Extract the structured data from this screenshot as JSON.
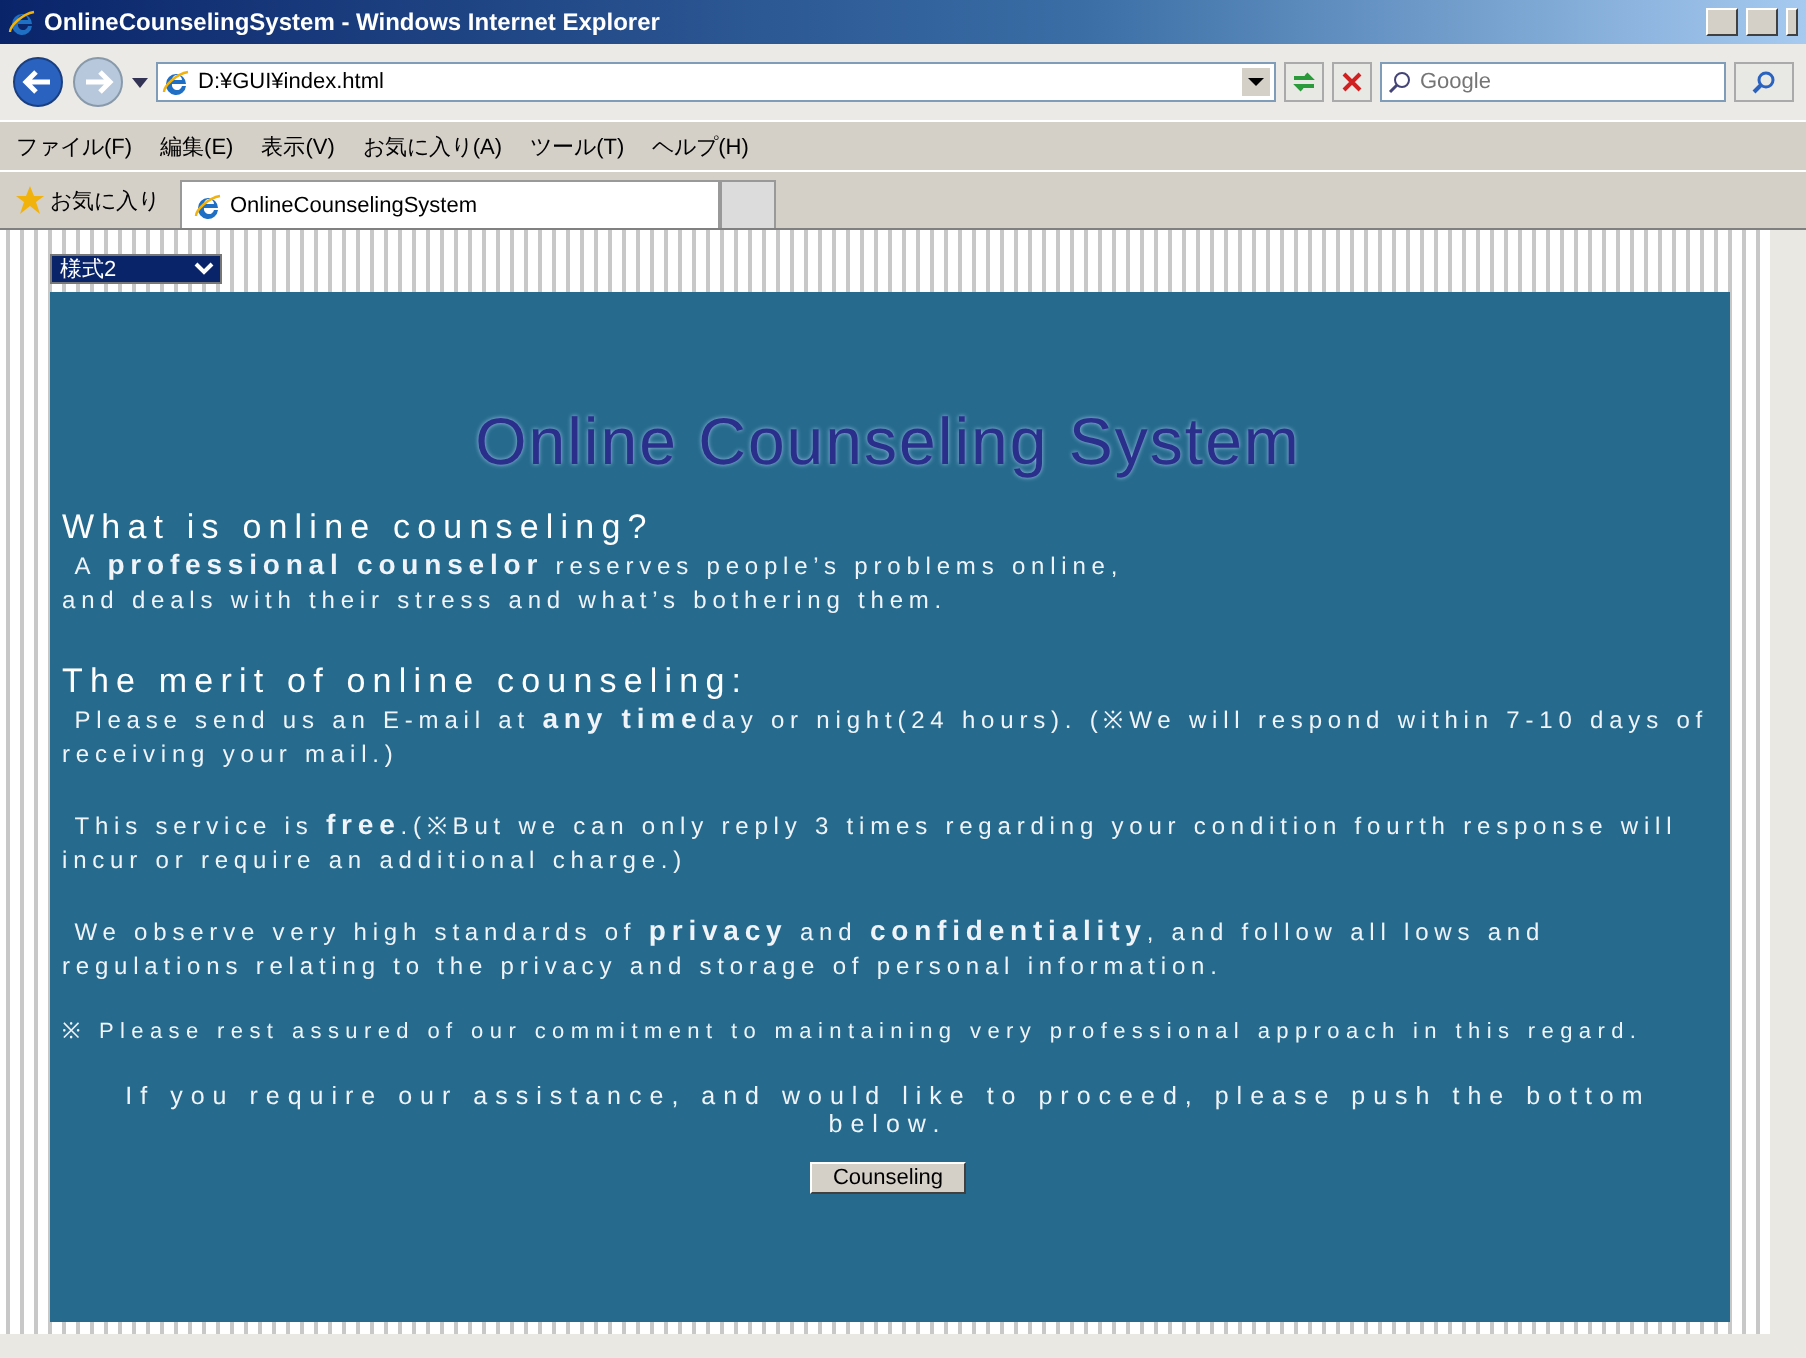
{
  "window": {
    "title": "OnlineCounselingSystem - Windows Internet Explorer"
  },
  "address_bar": {
    "url": "D:¥GUI¥index.html"
  },
  "search": {
    "placeholder": "Google"
  },
  "menu": [
    "ファイル(F)",
    "編集(E)",
    "表示(V)",
    "お気に入り(A)",
    "ツール(T)",
    "ヘルプ(H)"
  ],
  "favorites": {
    "label": "お気に入り"
  },
  "tabs": [
    {
      "label": "OnlineCounselingSystem",
      "selected": true
    }
  ],
  "style_select": {
    "value": "様式2"
  },
  "page": {
    "title": "Online Counseling System",
    "sections": [
      {
        "kind": "heading",
        "text": "What is online counseling?"
      },
      {
        "kind": "para",
        "text": " A **professional counselor** reserves people’s problems online,\nand deals with their stress and what’s bothering them."
      },
      {
        "kind": "heading",
        "text": "The merit of online counseling:"
      },
      {
        "kind": "para",
        "text": " Please send us an E-mail at **any time**day or night(24 hours). (※We will respond within 7-10 days of receiving your mail.)"
      },
      {
        "kind": "para",
        "text": " This service is **free**.(※But we can only reply 3 times regarding your condition fourth response will incur or require an additional charge.)"
      },
      {
        "kind": "para",
        "text": " We observe very high standards of **privacy** and **confidentiality**, and follow all lows and regulations relating to the privacy and storage of personal information."
      },
      {
        "kind": "note",
        "text": "※ Please rest assured of our commitment to maintaining very professional approach in this regard."
      },
      {
        "kind": "center",
        "text": "If you require our assistance, and would like to proceed, please push the bottom below."
      }
    ],
    "button": "Counseling"
  }
}
